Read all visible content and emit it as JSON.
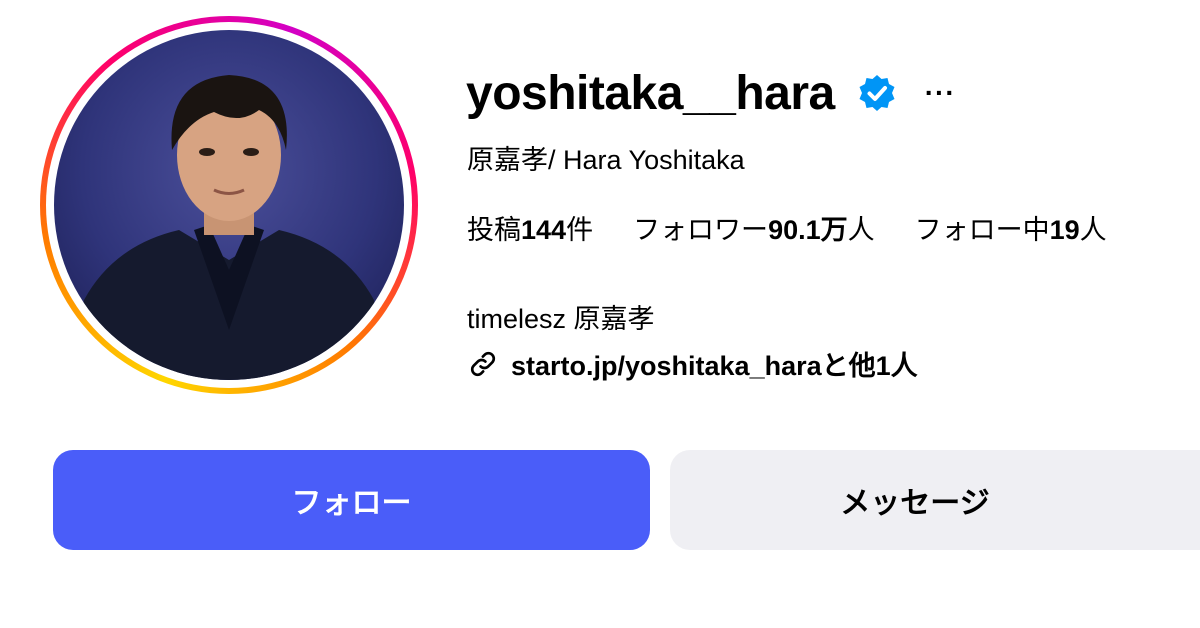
{
  "profile": {
    "username": "yoshitaka__hara",
    "verified": true,
    "full_name": "原嘉孝/ Hara Yoshitaka",
    "bio": "timelesz 原嘉孝",
    "link_text": "starto.jp/yoshitaka_haraと他1人",
    "more_label": "···"
  },
  "stats": {
    "posts_label": "投稿",
    "posts_value": "144",
    "posts_suffix": "件",
    "followers_label": "フォロワー",
    "followers_value": "90.1万",
    "followers_suffix": "人",
    "following_label": "フォロー中",
    "following_value": "19",
    "following_suffix": "人"
  },
  "actions": {
    "follow_label": "フォロー",
    "message_label": "メッセージ"
  },
  "colors": {
    "follow_button": "#4a5df9",
    "message_button": "#efeff3",
    "verified_badge": "#0095f6",
    "story_ring": [
      "#ffd600",
      "#ff7a00",
      "#ff0069",
      "#d300c5"
    ]
  },
  "icons": {
    "verified": "verified-badge-icon",
    "link": "link-icon",
    "more": "more-options-icon"
  }
}
